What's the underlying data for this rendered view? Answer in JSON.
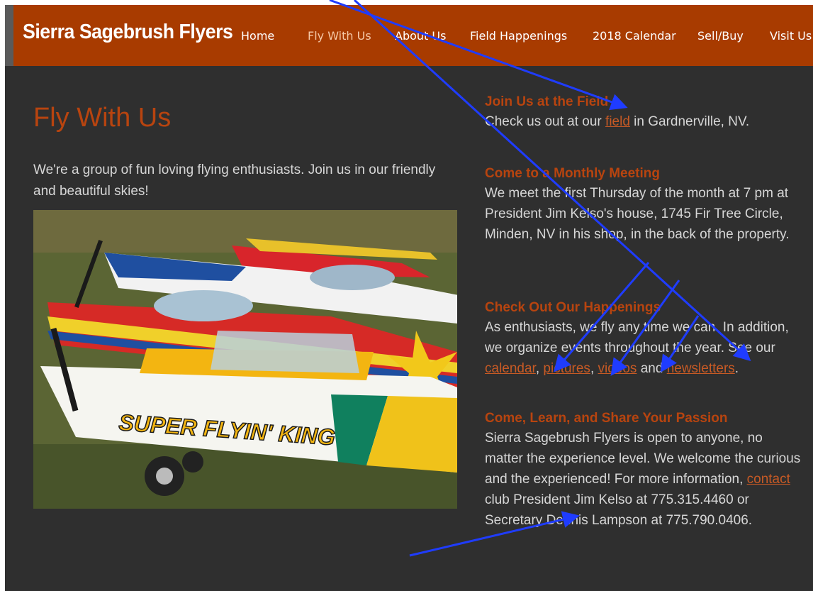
{
  "header": {
    "site_title": "Sierra Sagebrush Flyers",
    "nav": [
      {
        "label": "Home"
      },
      {
        "label": "Fly With Us"
      },
      {
        "label": "About Us"
      },
      {
        "label": "Field Happenings"
      },
      {
        "label": "2018 Calendar"
      },
      {
        "label": "Sell/Buy"
      },
      {
        "label": "Visit Us"
      }
    ]
  },
  "main": {
    "title": "Fly With Us",
    "intro": "We're a group of fun loving flying enthusiasts.  Join us in our friendly and beautiful skies!",
    "photo_text": "SUPER FLYIN' KING"
  },
  "sections": {
    "join": {
      "heading": "Join Us at the Field",
      "before": "Check us out at our ",
      "link": "field",
      "after": " in Gardnerville, NV."
    },
    "meeting": {
      "heading": "Come to a Monthly Meeting",
      "body": "We meet the first Thursday of the month at 7 pm at President Jim Kelso's house, 1745 Fir Tree Circle, Minden, NV in his shop, in the back of the property."
    },
    "happenings": {
      "heading": "Check Out Our Happenings",
      "before": "As enthusiasts, we fly any time we can.  In addition, we organize events throughout the year. See our ",
      "link_calendar": "calendar",
      "sep1": ", ",
      "link_pictures": "pictures",
      "sep2": ", ",
      "link_videos": "videos",
      "sep3": " and ",
      "link_newsletters": "newsletters",
      "end": "."
    },
    "passion": {
      "heading": "Come, Learn, and Share Your Passion",
      "before": "Sierra Sagebrush Flyers is open to anyone, no matter the experience level.  We welcome the curious and the experienced!  For more information, ",
      "link": "contact",
      "after": " club President Jim Kelso at 775.315.4460 or Secretary Dennis Lampson at 775.790.0406."
    }
  },
  "colors": {
    "header_bg": "#a83b00",
    "page_bg": "#2f2f2f",
    "accent": "#b8440f",
    "annotation_arrow": "#1f3cff"
  }
}
